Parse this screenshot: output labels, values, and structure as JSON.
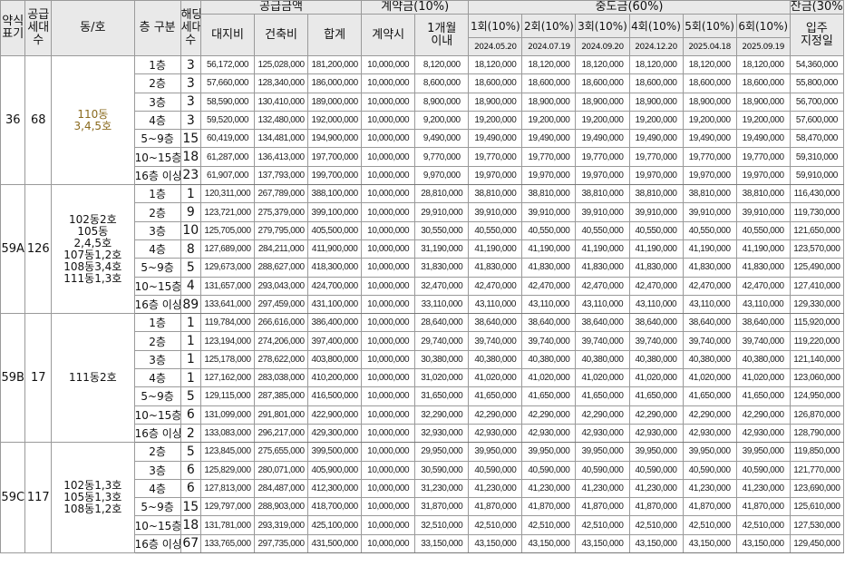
{
  "headers": {
    "type": "약식\n표기",
    "units": "공급\n세대\n수",
    "dongho": "동/호",
    "floor": "층 구분",
    "floor_units": "해당\n세대\n수",
    "supply": "공급금액",
    "land": "대지비",
    "building": "건축비",
    "total": "합계",
    "deposit": "계약금(10%)",
    "on_contract": "계약시",
    "within_month": "1개월\n이내",
    "middle": "중도금(60%)",
    "balance": "잔금(30%)",
    "movein": "입주\n지정일",
    "installments": [
      {
        "label": "1회(10%)",
        "date": "2024.05.20"
      },
      {
        "label": "2회(10%)",
        "date": "2024.07.19"
      },
      {
        "label": "3회(10%)",
        "date": "2024.09.20"
      },
      {
        "label": "4회(10%)",
        "date": "2024.12.20"
      },
      {
        "label": "5회(10%)",
        "date": "2025.04.18"
      },
      {
        "label": "6회(10%)",
        "date": "2025.09.19"
      }
    ]
  },
  "groups": [
    {
      "type": "36",
      "units": "68",
      "dongho": "110동\n3,4,5호",
      "dongho_color": "gold",
      "rows": [
        [
          "1층",
          "3",
          "56,172,000",
          "125,028,000",
          "181,200,000",
          "10,000,000",
          "8,120,000",
          "18,120,000",
          "18,120,000",
          "18,120,000",
          "18,120,000",
          "18,120,000",
          "18,120,000",
          "54,360,000"
        ],
        [
          "2층",
          "3",
          "57,660,000",
          "128,340,000",
          "186,000,000",
          "10,000,000",
          "8,600,000",
          "18,600,000",
          "18,600,000",
          "18,600,000",
          "18,600,000",
          "18,600,000",
          "18,600,000",
          "55,800,000"
        ],
        [
          "3층",
          "3",
          "58,590,000",
          "130,410,000",
          "189,000,000",
          "10,000,000",
          "8,900,000",
          "18,900,000",
          "18,900,000",
          "18,900,000",
          "18,900,000",
          "18,900,000",
          "18,900,000",
          "56,700,000"
        ],
        [
          "4층",
          "3",
          "59,520,000",
          "132,480,000",
          "192,000,000",
          "10,000,000",
          "9,200,000",
          "19,200,000",
          "19,200,000",
          "19,200,000",
          "19,200,000",
          "19,200,000",
          "19,200,000",
          "57,600,000"
        ],
        [
          "5~9층",
          "15",
          "60,419,000",
          "134,481,000",
          "194,900,000",
          "10,000,000",
          "9,490,000",
          "19,490,000",
          "19,490,000",
          "19,490,000",
          "19,490,000",
          "19,490,000",
          "19,490,000",
          "58,470,000"
        ],
        [
          "10~15층",
          "18",
          "61,287,000",
          "136,413,000",
          "197,700,000",
          "10,000,000",
          "9,770,000",
          "19,770,000",
          "19,770,000",
          "19,770,000",
          "19,770,000",
          "19,770,000",
          "19,770,000",
          "59,310,000"
        ],
        [
          "16층 이상",
          "23",
          "61,907,000",
          "137,793,000",
          "199,700,000",
          "10,000,000",
          "9,970,000",
          "19,970,000",
          "19,970,000",
          "19,970,000",
          "19,970,000",
          "19,970,000",
          "19,970,000",
          "59,910,000"
        ]
      ]
    },
    {
      "type": "59A",
      "units": "126",
      "dongho": "102동2호\n105동\n2,4,5호\n107동1,2호\n108동3,4호\n111동1,3호",
      "dongho_color": "normal",
      "rows": [
        [
          "1층",
          "1",
          "120,311,000",
          "267,789,000",
          "388,100,000",
          "10,000,000",
          "28,810,000",
          "38,810,000",
          "38,810,000",
          "38,810,000",
          "38,810,000",
          "38,810,000",
          "38,810,000",
          "116,430,000"
        ],
        [
          "2층",
          "9",
          "123,721,000",
          "275,379,000",
          "399,100,000",
          "10,000,000",
          "29,910,000",
          "39,910,000",
          "39,910,000",
          "39,910,000",
          "39,910,000",
          "39,910,000",
          "39,910,000",
          "119,730,000"
        ],
        [
          "3층",
          "10",
          "125,705,000",
          "279,795,000",
          "405,500,000",
          "10,000,000",
          "30,550,000",
          "40,550,000",
          "40,550,000",
          "40,550,000",
          "40,550,000",
          "40,550,000",
          "40,550,000",
          "121,650,000"
        ],
        [
          "4층",
          "8",
          "127,689,000",
          "284,211,000",
          "411,900,000",
          "10,000,000",
          "31,190,000",
          "41,190,000",
          "41,190,000",
          "41,190,000",
          "41,190,000",
          "41,190,000",
          "41,190,000",
          "123,570,000"
        ],
        [
          "5~9층",
          "5",
          "129,673,000",
          "288,627,000",
          "418,300,000",
          "10,000,000",
          "31,830,000",
          "41,830,000",
          "41,830,000",
          "41,830,000",
          "41,830,000",
          "41,830,000",
          "41,830,000",
          "125,490,000"
        ],
        [
          "10~15층",
          "4",
          "131,657,000",
          "293,043,000",
          "424,700,000",
          "10,000,000",
          "32,470,000",
          "42,470,000",
          "42,470,000",
          "42,470,000",
          "42,470,000",
          "42,470,000",
          "42,470,000",
          "127,410,000"
        ],
        [
          "16층 이상",
          "89",
          "133,641,000",
          "297,459,000",
          "431,100,000",
          "10,000,000",
          "33,110,000",
          "43,110,000",
          "43,110,000",
          "43,110,000",
          "43,110,000",
          "43,110,000",
          "43,110,000",
          "129,330,000"
        ]
      ]
    },
    {
      "type": "59B",
      "units": "17",
      "dongho": "111동2호",
      "dongho_color": "normal",
      "rows": [
        [
          "1층",
          "1",
          "119,784,000",
          "266,616,000",
          "386,400,000",
          "10,000,000",
          "28,640,000",
          "38,640,000",
          "38,640,000",
          "38,640,000",
          "38,640,000",
          "38,640,000",
          "38,640,000",
          "115,920,000"
        ],
        [
          "2층",
          "1",
          "123,194,000",
          "274,206,000",
          "397,400,000",
          "10,000,000",
          "29,740,000",
          "39,740,000",
          "39,740,000",
          "39,740,000",
          "39,740,000",
          "39,740,000",
          "39,740,000",
          "119,220,000"
        ],
        [
          "3층",
          "1",
          "125,178,000",
          "278,622,000",
          "403,800,000",
          "10,000,000",
          "30,380,000",
          "40,380,000",
          "40,380,000",
          "40,380,000",
          "40,380,000",
          "40,380,000",
          "40,380,000",
          "121,140,000"
        ],
        [
          "4층",
          "1",
          "127,162,000",
          "283,038,000",
          "410,200,000",
          "10,000,000",
          "31,020,000",
          "41,020,000",
          "41,020,000",
          "41,020,000",
          "41,020,000",
          "41,020,000",
          "41,020,000",
          "123,060,000"
        ],
        [
          "5~9층",
          "5",
          "129,115,000",
          "287,385,000",
          "416,500,000",
          "10,000,000",
          "31,650,000",
          "41,650,000",
          "41,650,000",
          "41,650,000",
          "41,650,000",
          "41,650,000",
          "41,650,000",
          "124,950,000"
        ],
        [
          "10~15층",
          "6",
          "131,099,000",
          "291,801,000",
          "422,900,000",
          "10,000,000",
          "32,290,000",
          "42,290,000",
          "42,290,000",
          "42,290,000",
          "42,290,000",
          "42,290,000",
          "42,290,000",
          "126,870,000"
        ],
        [
          "16층 이상",
          "2",
          "133,083,000",
          "296,217,000",
          "429,300,000",
          "10,000,000",
          "32,930,000",
          "42,930,000",
          "42,930,000",
          "42,930,000",
          "42,930,000",
          "42,930,000",
          "42,930,000",
          "128,790,000"
        ]
      ]
    },
    {
      "type": "59C",
      "units": "117",
      "dongho": "102동1,3호\n105동1,3호\n108동1,2호",
      "dongho_color": "normal",
      "rows": [
        [
          "2층",
          "5",
          "123,845,000",
          "275,655,000",
          "399,500,000",
          "10,000,000",
          "29,950,000",
          "39,950,000",
          "39,950,000",
          "39,950,000",
          "39,950,000",
          "39,950,000",
          "39,950,000",
          "119,850,000"
        ],
        [
          "3층",
          "6",
          "125,829,000",
          "280,071,000",
          "405,900,000",
          "10,000,000",
          "30,590,000",
          "40,590,000",
          "40,590,000",
          "40,590,000",
          "40,590,000",
          "40,590,000",
          "40,590,000",
          "121,770,000"
        ],
        [
          "4층",
          "6",
          "127,813,000",
          "284,487,000",
          "412,300,000",
          "10,000,000",
          "31,230,000",
          "41,230,000",
          "41,230,000",
          "41,230,000",
          "41,230,000",
          "41,230,000",
          "41,230,000",
          "123,690,000"
        ],
        [
          "5~9층",
          "15",
          "129,797,000",
          "288,903,000",
          "418,700,000",
          "10,000,000",
          "31,870,000",
          "41,870,000",
          "41,870,000",
          "41,870,000",
          "41,870,000",
          "41,870,000",
          "41,870,000",
          "125,610,000"
        ],
        [
          "10~15층",
          "18",
          "131,781,000",
          "293,319,000",
          "425,100,000",
          "10,000,000",
          "32,510,000",
          "42,510,000",
          "42,510,000",
          "42,510,000",
          "42,510,000",
          "42,510,000",
          "42,510,000",
          "127,530,000"
        ],
        [
          "16층 이상",
          "67",
          "133,765,000",
          "297,735,000",
          "431,500,000",
          "10,000,000",
          "33,150,000",
          "43,150,000",
          "43,150,000",
          "43,150,000",
          "43,150,000",
          "43,150,000",
          "43,150,000",
          "129,450,000"
        ]
      ]
    }
  ]
}
